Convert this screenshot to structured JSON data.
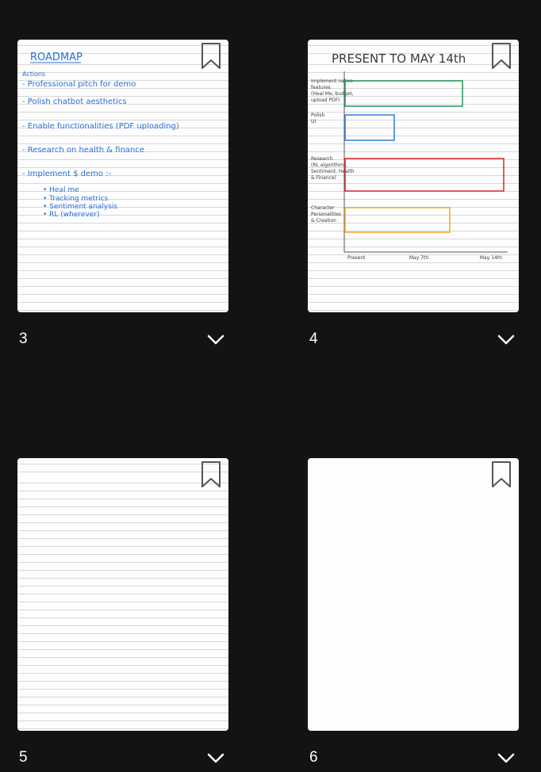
{
  "pages": [
    {
      "number": "3",
      "lined": true,
      "notes": {
        "title": "ROADMAP",
        "subtitle": "Actions",
        "items": [
          "- Professional pitch for demo",
          "- Polish chatbot aesthetics",
          "- Enable functionalities (PDF uploading)",
          "- Research on health & finance",
          "- Implement $ demo :-"
        ],
        "subitems": [
          "• Heal me",
          "• Tracking metrics",
          "• Sentiment analysis",
          "• RL (wherever)"
        ]
      }
    },
    {
      "number": "4",
      "lined": true,
      "gantt": {
        "title": "PRESENT TO MAY 14th",
        "rows": [
          {
            "label_lines": [
              "Implement native",
              "features",
              "(Heal Me, budget,",
              "upload PDF)"
            ],
            "start": 0,
            "end": 0.74,
            "color": "#1f9a5a"
          },
          {
            "label_lines": [
              "Polish",
              "UI"
            ],
            "start": 0,
            "end": 0.31,
            "color": "#2b7fd9"
          },
          {
            "label_lines": [
              "Research",
              "(RL algorithms,",
              "Sentiment, Health",
              "& Finance)"
            ],
            "start": 0,
            "end": 1.0,
            "color": "#d9262c"
          },
          {
            "label_lines": [
              "Character",
              "Personalities",
              "& Creation"
            ],
            "start": 0,
            "end": 0.66,
            "color": "#f0a528"
          }
        ],
        "ticks": [
          "Present",
          "May 7th",
          "May 14th"
        ]
      }
    },
    {
      "number": "5",
      "lined": true
    },
    {
      "number": "6",
      "lined": false
    }
  ],
  "icons": {
    "bookmark": "bookmark-icon",
    "expand": "chevron-down-icon"
  },
  "colors": {
    "background": "#151312",
    "page": "#fdfdfd",
    "ink": "#2a6fd6"
  }
}
